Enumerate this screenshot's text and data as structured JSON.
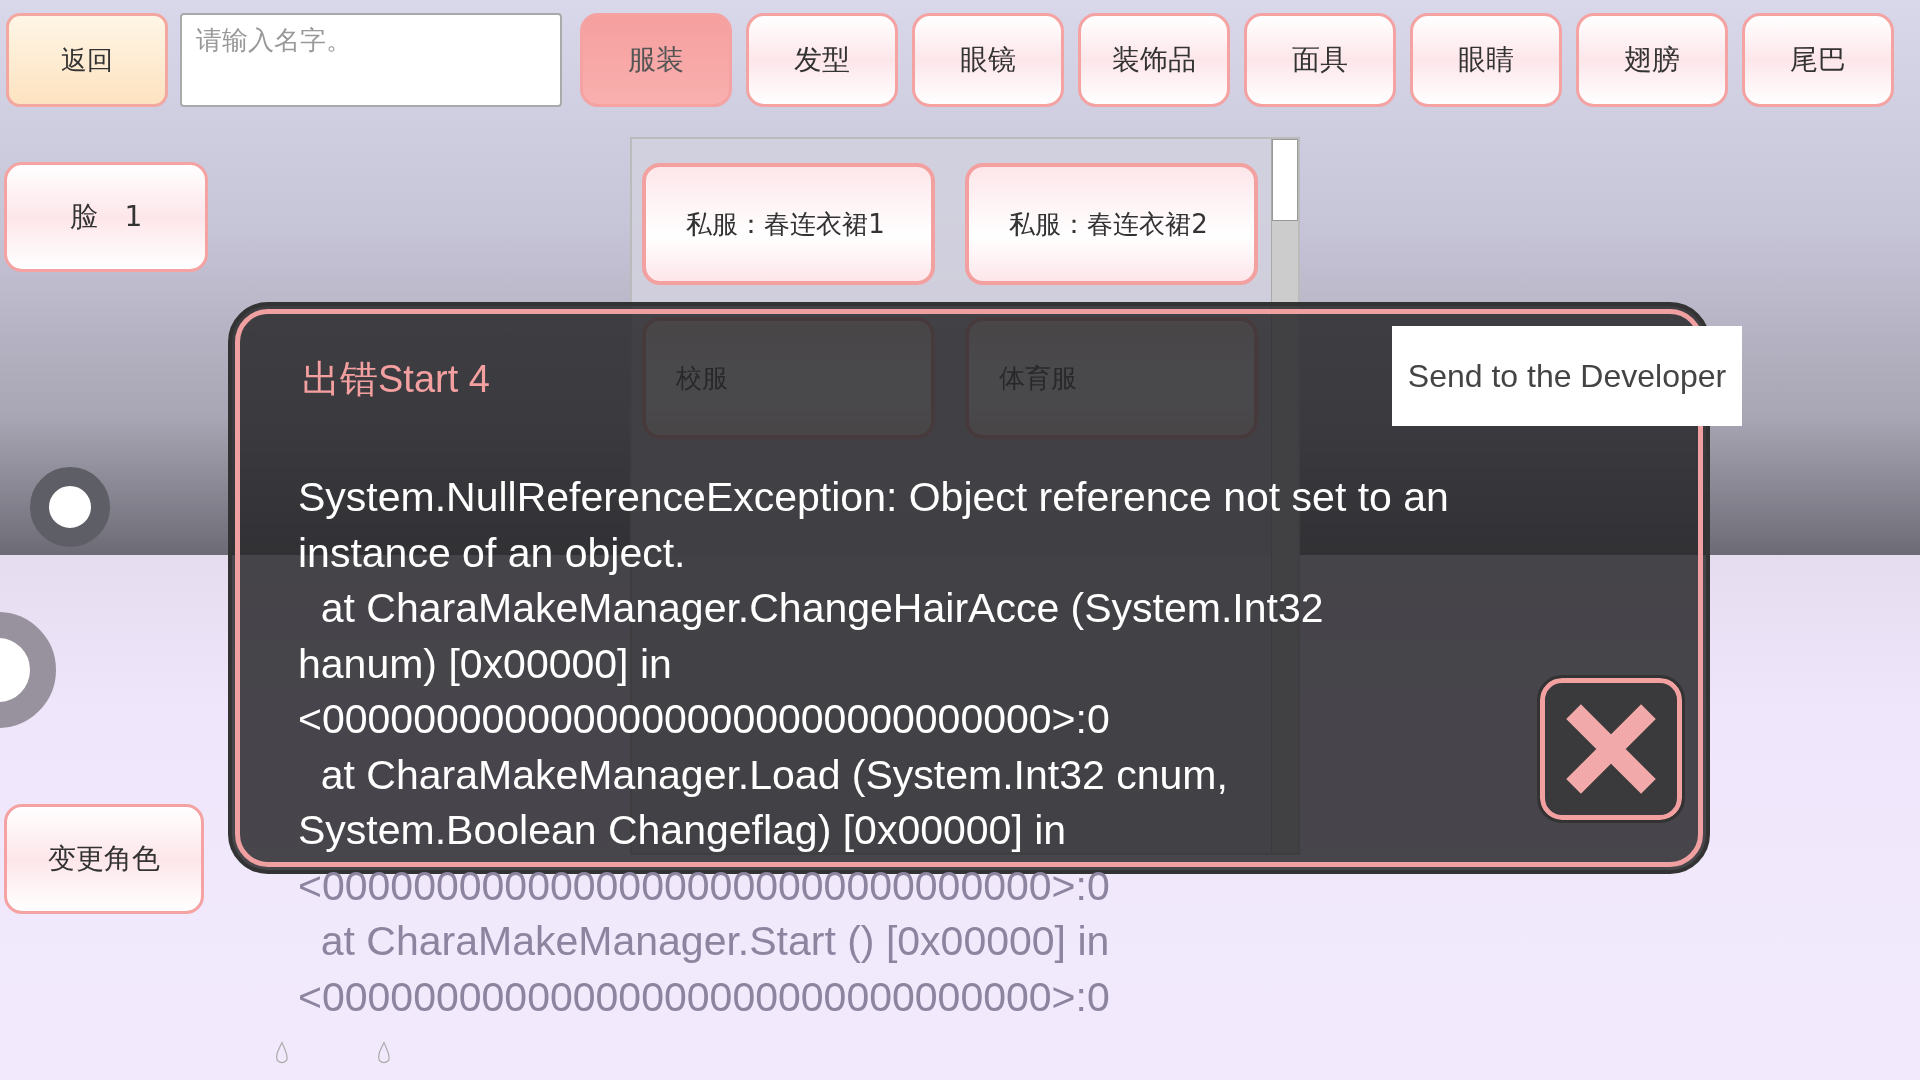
{
  "top_bar": {
    "back_button": "返回",
    "name_field": {
      "placeholder": "请输入名字。"
    },
    "tabs": [
      {
        "label": "服装",
        "selected": true
      },
      {
        "label": "发型",
        "selected": false
      },
      {
        "label": "眼镜",
        "selected": false
      },
      {
        "label": "装饰品",
        "selected": false
      },
      {
        "label": "面具",
        "selected": false
      },
      {
        "label": "眼睛",
        "selected": false
      },
      {
        "label": "翅膀",
        "selected": false
      },
      {
        "label": "尾巴",
        "selected": false
      }
    ]
  },
  "face_button": {
    "label": "脸",
    "value": "1"
  },
  "change_character_button": "变更角色",
  "outfits": [
    "私服：春连衣裙1",
    "私服：春连衣裙2",
    "校服",
    "体育服"
  ],
  "error_dialog": {
    "title": "出错Start 4",
    "send_button": "Send to the Developer",
    "message_lines": [
      "System.NullReferenceException: Object reference not set to an",
      "instance of an object.",
      "  at CharaMakeManager.ChangeHairAcce (System.Int32",
      "hanum) [0x00000] in",
      "<00000000000000000000000000000000>:0",
      "  at CharaMakeManager.Load (System.Int32 cnum,",
      "System.Boolean Changeflag) [0x00000] in",
      "<00000000000000000000000000000000>:0",
      "  at CharaMakeManager.Start () [0x00000] in",
      "<00000000000000000000000000000000>:0"
    ]
  }
}
